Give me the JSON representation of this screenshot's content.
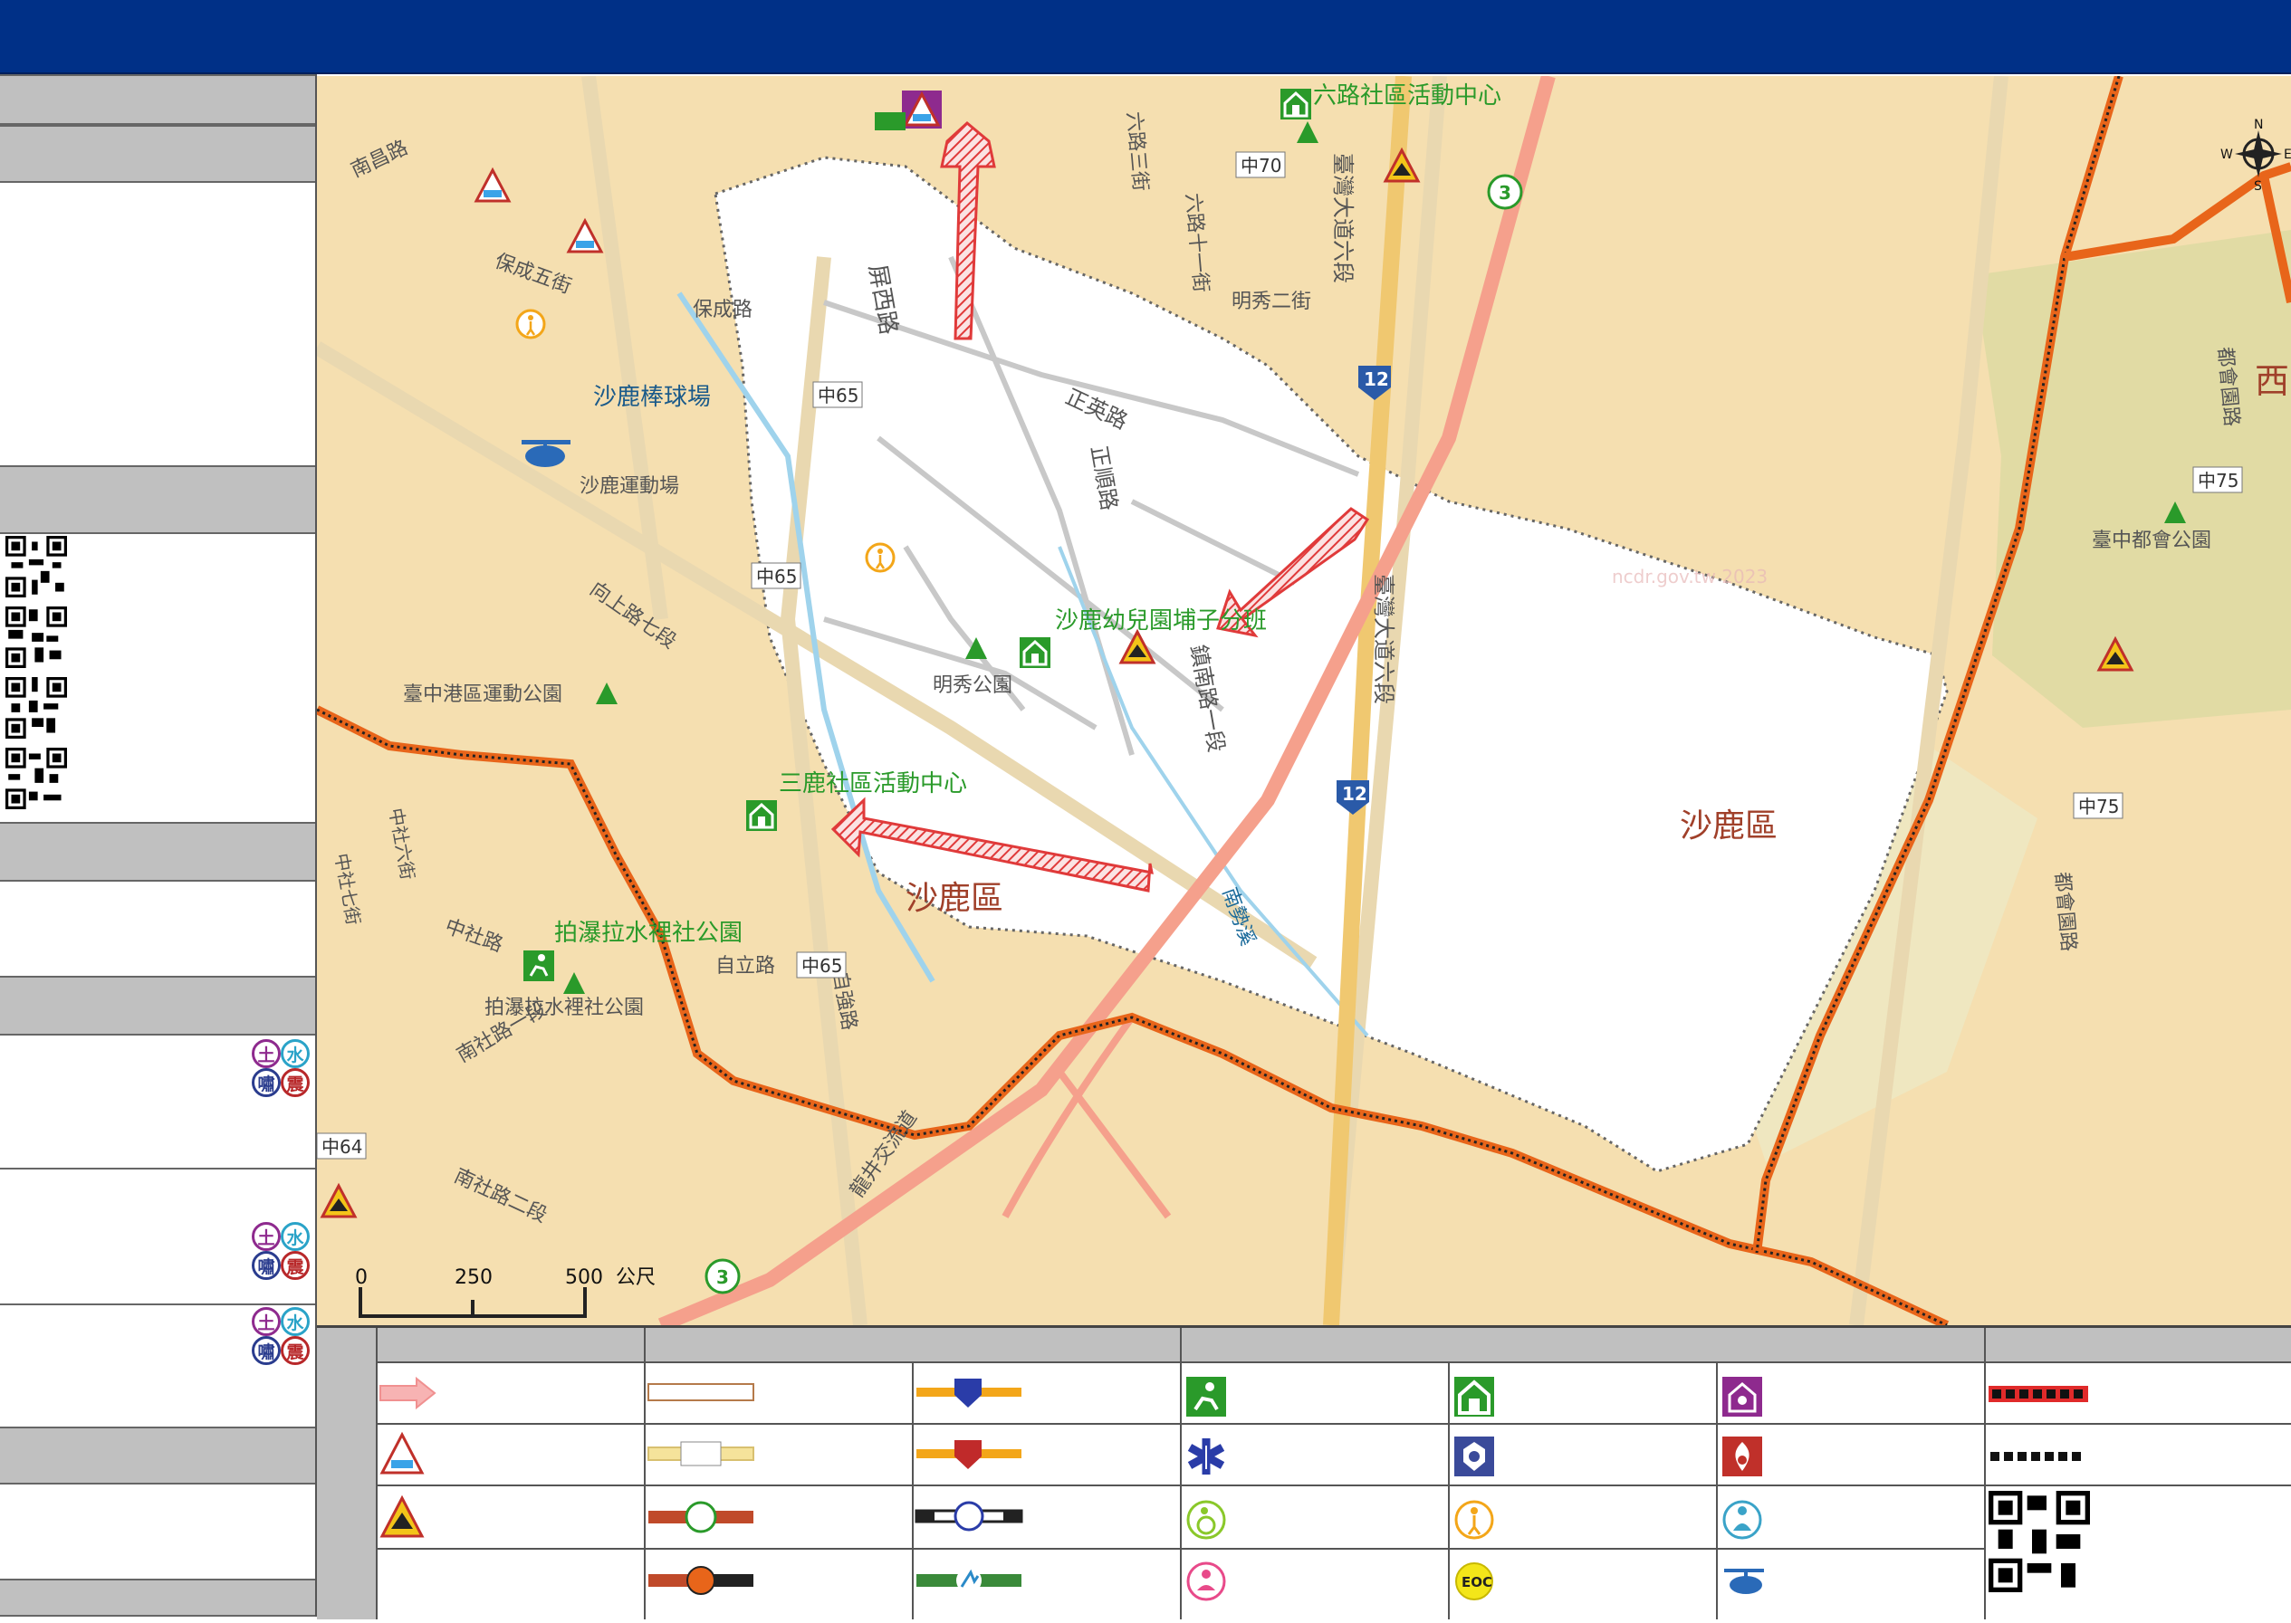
{
  "map": {
    "district_labels": [
      "沙鹿區",
      "沙鹿區",
      "西"
    ],
    "facility_labels": [
      "六路社區活動中心",
      "沙鹿幼兒園埔子分班",
      "三鹿社區活動中心",
      "拍瀑拉水裡社公園",
      "沙鹿棒球場"
    ],
    "road_labels": [
      "屏西路",
      "正英路",
      "正順路",
      "南勢溪",
      "保成路",
      "保成五街",
      "南昌路",
      "臺灣大道六段",
      "臺灣大道六段",
      "鎮南路一段",
      "向上路七段",
      "自強路",
      "自立路",
      "中社路",
      "南社路一段",
      "南社路二段",
      "都會園路",
      "都會園路",
      "明秀二街",
      "六路十一街",
      "六路三街",
      "中社六街",
      "中社七街",
      "龍井交流道"
    ],
    "road_markers": [
      "中70",
      "中65",
      "中65",
      "中65",
      "中64",
      "中75",
      "中75",
      "12",
      "12",
      "3",
      "3"
    ],
    "poi_labels": [
      "明秀公園",
      "臺中都會公園",
      "臺中港區運動公園",
      "沙鹿運動場",
      "拍瀑拉水裡社公園"
    ],
    "scale": {
      "ticks": [
        "0",
        "250",
        "500"
      ],
      "unit": "公尺"
    },
    "compass": [
      "N",
      "E",
      "S",
      "W"
    ],
    "watermark": "ncdr.gov.tw 2023"
  },
  "legend": {
    "eoc_label": "EOC"
  },
  "colors": {
    "header": "#003087",
    "band": "#c0c0c0",
    "boundary": "#e8651a",
    "arrow": "#e03a3a",
    "area": "#ffffff",
    "base": "#f5dfb0"
  }
}
